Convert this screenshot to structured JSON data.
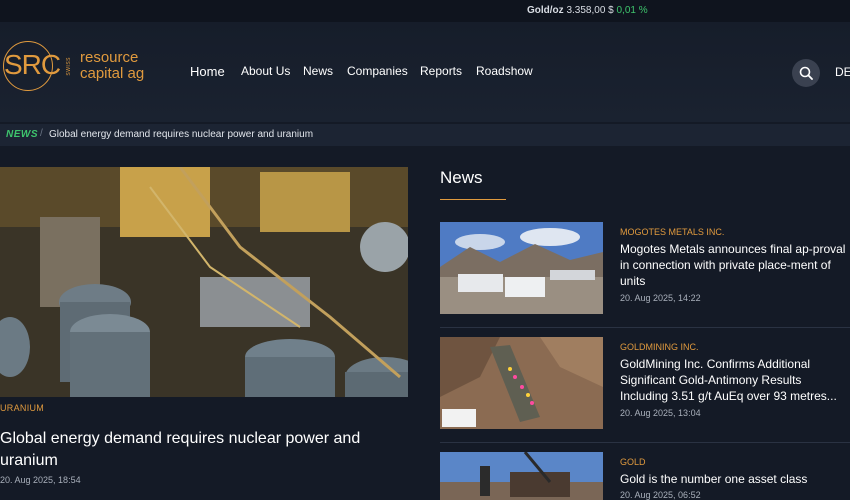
{
  "ticker": {
    "label": "Gold/oz",
    "price": "3.358,00 $",
    "change": "0,01 %"
  },
  "logo": {
    "abbr": "SRC",
    "swiss": "SWISS",
    "line1": "resource",
    "line2": "capital ag"
  },
  "nav": {
    "items": [
      "Home",
      "About Us",
      "News",
      "Companies",
      "Reports",
      "Roadshow"
    ],
    "lang": "DE"
  },
  "breadcrumb": {
    "section": "NEWS",
    "separator": "/",
    "title": "Global energy demand requires nuclear power and uranium"
  },
  "hero": {
    "category": "URANIUM",
    "title": "Global energy demand requires nuclear power and uranium",
    "date": "20. Aug 2025, 18:54"
  },
  "news": {
    "heading": "News",
    "items": [
      {
        "category": "MOGOTES METALS INC.",
        "title": "Mogotes Metals announces final ap-proval in connection with private place-ment of units",
        "date": "20. Aug 2025, 14:22"
      },
      {
        "category": "GOLDMINING INC.",
        "title": "GoldMining Inc. Confirms Additional Significant Gold-Antimony Results Including 3.51 g/t AuEq over 93 metres...",
        "date": "20. Aug 2025, 13:04"
      },
      {
        "category": "GOLD",
        "title": "Gold is the number one asset class",
        "date": "20. Aug 2025, 06:52"
      }
    ]
  },
  "colors": {
    "accent": "#e09a3e",
    "green": "#3ec46d",
    "background": "#141a26"
  }
}
